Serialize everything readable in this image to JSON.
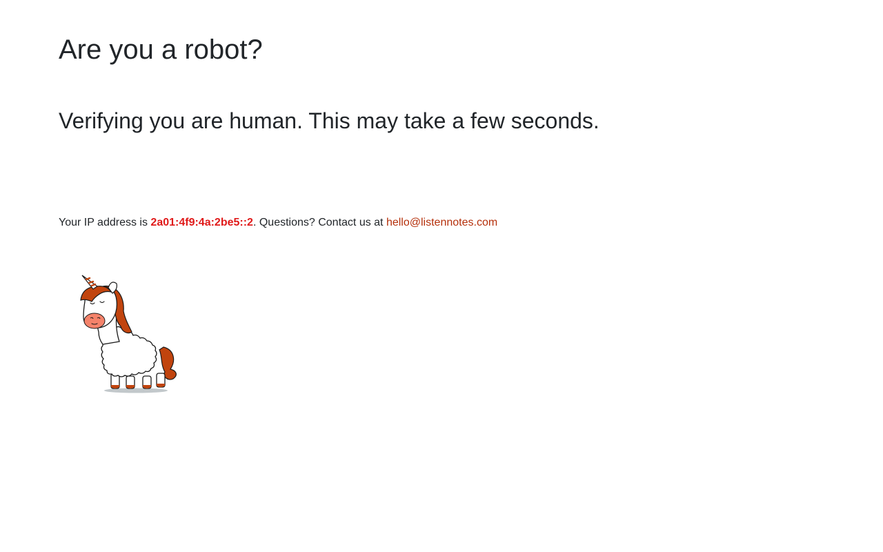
{
  "heading": {
    "title": "Are you a robot?",
    "subtitle": "Verifying you are human. This may take a few seconds."
  },
  "contact": {
    "prefix": "Your IP address is ",
    "ip": "2a01:4f9:4a:2be5::2",
    "middle": ". Questions? Contact us at ",
    "email": "hello@listennotes.com"
  },
  "mascot": {
    "icon": "unicorn-llama-icon"
  },
  "colors": {
    "text": "#212529",
    "ip": "#e01a1a",
    "link": "#b5300b",
    "mane": "#c1440e",
    "cheek": "#f4826a"
  }
}
